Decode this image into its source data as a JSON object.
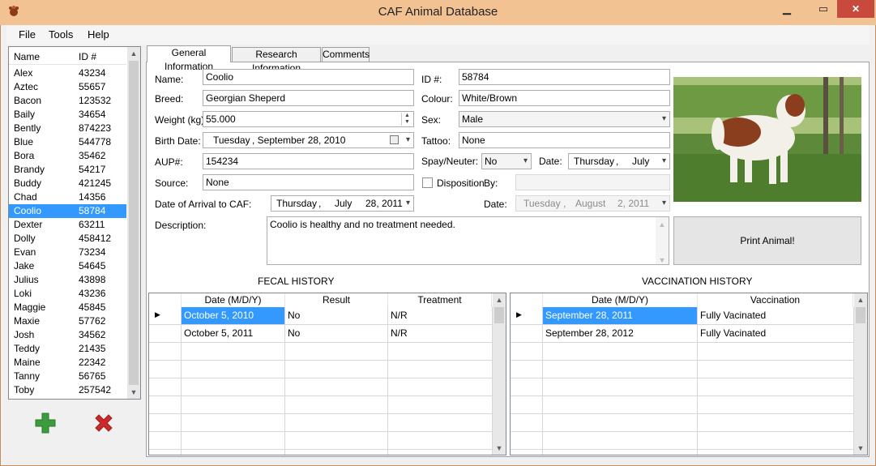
{
  "window": {
    "title": "CAF Animal Database",
    "minimize": "▁",
    "maximize": "▭",
    "close": "✕"
  },
  "menu": {
    "file": "File",
    "tools": "Tools",
    "help": "Help"
  },
  "animal_list": {
    "col_name": "Name",
    "col_id": "ID #",
    "rows": [
      {
        "name": "Alex",
        "id": "43234"
      },
      {
        "name": "Aztec",
        "id": "55657"
      },
      {
        "name": "Bacon",
        "id": "123532"
      },
      {
        "name": "Baily",
        "id": "34654"
      },
      {
        "name": "Bently",
        "id": "874223"
      },
      {
        "name": "Blue",
        "id": "544778"
      },
      {
        "name": "Bora",
        "id": "35462"
      },
      {
        "name": "Brandy",
        "id": "54217"
      },
      {
        "name": "Buddy",
        "id": "421245"
      },
      {
        "name": "Chad",
        "id": "14356"
      },
      {
        "name": "Coolio",
        "id": "58784"
      },
      {
        "name": "Dexter",
        "id": "63211"
      },
      {
        "name": "Dolly",
        "id": "458412"
      },
      {
        "name": "Evan",
        "id": "73234"
      },
      {
        "name": "Jake",
        "id": "54645"
      },
      {
        "name": "Julius",
        "id": "43898"
      },
      {
        "name": "Loki",
        "id": "43236"
      },
      {
        "name": "Maggie",
        "id": "45845"
      },
      {
        "name": "Maxie",
        "id": "57762"
      },
      {
        "name": "Josh",
        "id": "34562"
      },
      {
        "name": "Teddy",
        "id": "21435"
      },
      {
        "name": "Maine",
        "id": "22342"
      },
      {
        "name": "Tanny",
        "id": "56765"
      },
      {
        "name": "Toby",
        "id": "257542"
      }
    ],
    "selected_index": 10
  },
  "tabs": {
    "general": "General Information",
    "research": "Research Information",
    "comments": "Comments"
  },
  "form": {
    "name_label": "Name:",
    "name_value": "Coolio",
    "breed_label": "Breed:",
    "breed_value": "Georgian Sheperd",
    "weight_label": "Weight (kg):",
    "weight_value": "55.000",
    "birth_label": "Birth Date:",
    "birth_day": "Tuesday",
    "birth_date": ", September 28, 2010",
    "aup_label": "AUP#:",
    "aup_value": "154234",
    "source_label": "Source:",
    "source_value": "None",
    "arrival_label": "Date of Arrival to CAF:",
    "arrival_day": "Thursday",
    "arrival_sep": ",",
    "arrival_month": "July",
    "arrival_date": "28, 2011",
    "id_label": "ID #:",
    "id_value": "58784",
    "colour_label": "Colour:",
    "colour_value": "White/Brown",
    "sex_label": "Sex:",
    "sex_value": "Male",
    "tattoo_label": "Tattoo:",
    "tattoo_value": "None",
    "spay_label": "Spay/Neuter:",
    "spay_value": "No",
    "spay_date_label": "Date:",
    "spay_day": "Thursday",
    "spay_sep": ",",
    "spay_month": "July",
    "disposition_label": "Disposition",
    "by_label": "By:",
    "disp_date_label": "Date:",
    "disp_day": "Tuesday",
    "disp_sep": ",",
    "disp_month": "August",
    "disp_date": "2, 2011",
    "description_label": "Description:",
    "description_value": "Coolio is healthy and no treatment needed."
  },
  "print_button": "Print Animal!",
  "fecal": {
    "title": "FECAL HISTORY",
    "headers": [
      "Date (M/D/Y)",
      "Result",
      "Treatment"
    ],
    "rows": [
      [
        "October 5, 2010",
        "No",
        "N/R"
      ],
      [
        "October 5, 2011",
        "No",
        "N/R"
      ]
    ]
  },
  "vaccination": {
    "title": "VACCINATION HISTORY",
    "headers": [
      "Date (M/D/Y)",
      "Vaccination"
    ],
    "rows": [
      [
        "September 28, 2011",
        "Fully Vacinated"
      ],
      [
        "September 28, 2012",
        "Fully Vacinated"
      ]
    ]
  },
  "colors": {
    "titlebar": "#f2c293",
    "selection": "#3399ff",
    "add": "#3d9b3d",
    "delete": "#cc2a2a"
  },
  "icons": {
    "add": "plus-icon",
    "delete": "x-icon",
    "app": "dog-paw-icon",
    "dropdown": "chevron-down-icon",
    "calendar": "calendar-icon"
  }
}
